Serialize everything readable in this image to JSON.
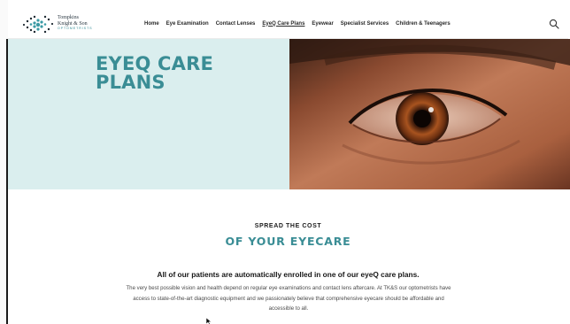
{
  "logo": {
    "line1": "Tompkins",
    "line2": "Knight & Son",
    "line3": "OPTOMETRISTS"
  },
  "nav": {
    "items": [
      {
        "label": "Home"
      },
      {
        "label": "Eye Examination"
      },
      {
        "label": "Contact Lenses"
      },
      {
        "label": "EyeQ Care Plans"
      },
      {
        "label": "Eyewear"
      },
      {
        "label": "Specialist Services"
      },
      {
        "label": "Children & Teenagers"
      }
    ],
    "active": "EyeQ Care Plans"
  },
  "icons": {
    "search": "search-icon"
  },
  "hero": {
    "title_line1": "EYEQ CARE",
    "title_line2": "PLANS"
  },
  "content": {
    "kicker": "SPREAD THE COST",
    "title": "OF YOUR EYECARE",
    "lead": "All of our patients are automatically enrolled in one of our eyeQ care plans.",
    "body": "The very best possible vision and health depend on regular eye examinations and contact lens aftercare. At TK&S our optometrists have access to state-of-the-art diagnostic equipment and we passionately believe that comprehensive eyecare should be affordable and accessible to all."
  },
  "colors": {
    "accent": "#3a8d95",
    "hero_bg": "#daeeee"
  }
}
